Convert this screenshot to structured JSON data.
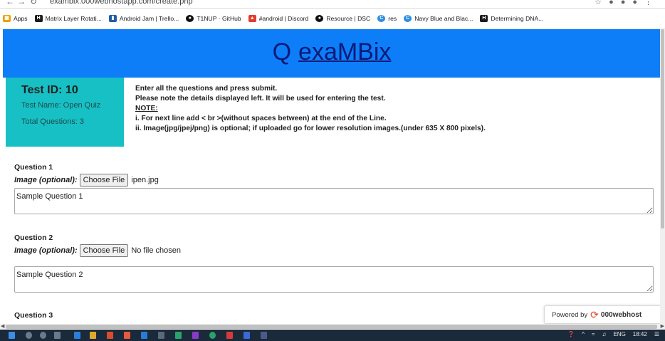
{
  "browser": {
    "url": "exambix.000webhostapp.com/create.php",
    "bookmarks": [
      {
        "label": "Apps",
        "icon": "apps-grid-icon",
        "color": "#e8a200"
      },
      {
        "label": "Matrix Layer Rotati...",
        "icon": "hackerrank-icon",
        "color": "#1c1c1c"
      },
      {
        "label": "Android Jam | Trello...",
        "icon": "trello-icon",
        "color": "#1f5fa8"
      },
      {
        "label": "T1NUP · GitHub",
        "icon": "github-icon",
        "color": "#111111"
      },
      {
        "label": "#android | Discord",
        "icon": "discord-icon",
        "color": "#e23c2c"
      },
      {
        "label": "Resource | DSC",
        "icon": "github-icon",
        "color": "#111111"
      },
      {
        "label": "res",
        "icon": "canva-icon",
        "color": "#2b8de0"
      },
      {
        "label": "Navy Blue and Blac...",
        "icon": "canva-icon",
        "color": "#2b8de0"
      },
      {
        "label": "Determining DNA...",
        "icon": "hackerrank-icon",
        "color": "#1c1c1c"
      }
    ]
  },
  "header": {
    "brand": "exaMBix",
    "brand_icon": "Q",
    "background": "#0d7ef8"
  },
  "info": {
    "test_id": "Test ID: 10",
    "test_name": "Test Name: Open Quiz",
    "total_questions": "Total Questions: 3"
  },
  "instructions": {
    "line1": "Enter all the questions and press submit.",
    "line2": "Please note the details displayed left. It will be used for entering the test.",
    "note": "NOTE:",
    "line3": "i. For next line add < br >(without spaces between) at the end of the Line.",
    "line4": "ii. Image(jpg/jpej/png) is optional; if uploaded go for lower resolution images.(under 635 X 800 pixels)."
  },
  "questions": [
    {
      "title": "Question 1",
      "image_label": "Image (optional):",
      "button": "Choose File",
      "file": "ipen.jpg",
      "text": "Sample Question 1"
    },
    {
      "title": "Question 2",
      "image_label": "Image (optional):",
      "button": "Choose File",
      "file": "No file chosen",
      "text": "Sample Question 2"
    },
    {
      "title": "Question 3"
    }
  ],
  "powered_by": {
    "label": "Powered by",
    "host": "000webhost"
  },
  "taskbar": {
    "language": "ENG",
    "time": "18:42"
  }
}
